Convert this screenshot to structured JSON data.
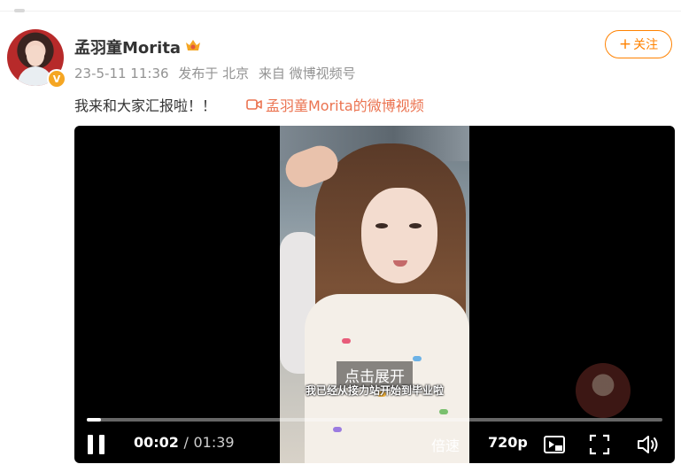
{
  "post": {
    "author": "孟羽童Morita",
    "date": "23-5-11 11:36",
    "published_from": "发布于 北京",
    "source": "来自 微博视频号",
    "follow_label": "关注",
    "text": "我来和大家汇报啦！！",
    "video_link": "孟羽童Morita的微博视频",
    "verified_badge": "V"
  },
  "player": {
    "expand_label": "点击展开",
    "subtitle": "我已经从接力站开始到毕业啦",
    "current_time": "00:02",
    "separator": "/",
    "total_time": "01:39",
    "speed_label": "倍速",
    "quality_label": "720p",
    "progress_fraction": 0.024
  },
  "icons": {
    "pause": "pause-icon",
    "pip": "picture-in-picture-icon",
    "fullscreen": "fullscreen-icon",
    "volume": "volume-icon",
    "video_link": "video-camera-icon",
    "crown": "crown-badge-icon"
  },
  "colors": {
    "accent": "#ff8200",
    "link": "#eb7350",
    "meta": "#939393"
  }
}
